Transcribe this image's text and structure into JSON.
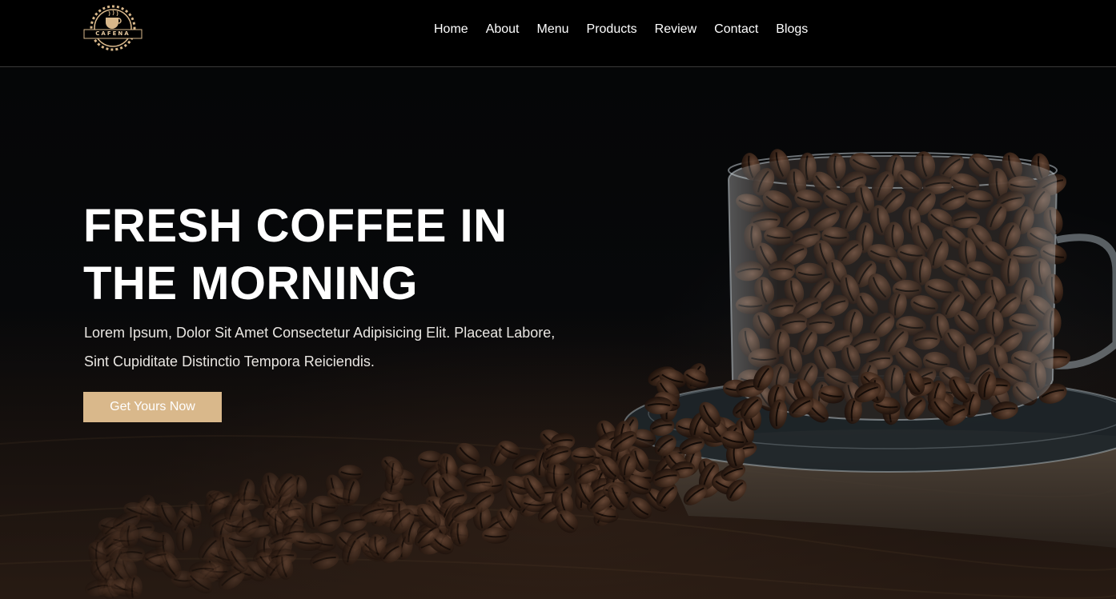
{
  "header": {
    "logo_text": "CAFENA",
    "nav": [
      {
        "label": "Home"
      },
      {
        "label": "About"
      },
      {
        "label": "Menu"
      },
      {
        "label": "Products"
      },
      {
        "label": "Review"
      },
      {
        "label": "Contact"
      },
      {
        "label": "Blogs"
      }
    ]
  },
  "hero": {
    "title": "FRESH COFFEE IN THE MORNING",
    "description": "Lorem Ipsum, Dolor Sit Amet Consectetur Adipisicing Elit. Placeat Labore, Sint Cupiditate Distinctio Tempora Reiciendis.",
    "cta_label": "Get Yours Now",
    "image": "coffee-beans-glass-cup"
  },
  "colors": {
    "accent": "#d9b88b",
    "header_bg": "#000000",
    "text": "#ffffff"
  }
}
